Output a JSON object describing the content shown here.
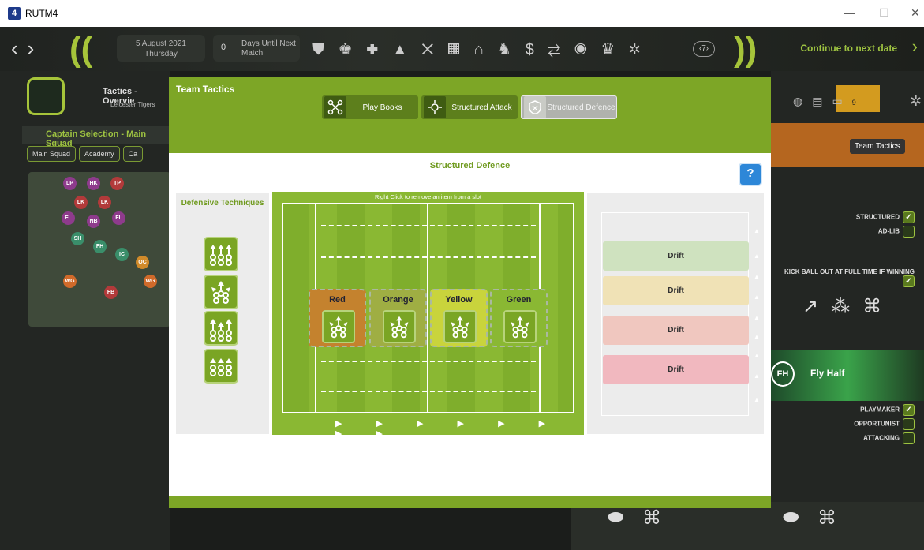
{
  "window": {
    "app_badge": "4",
    "title": "RUTM4",
    "minimize": "—",
    "maximize": "☐",
    "close": "✕"
  },
  "topbar": {
    "back": "‹",
    "forward": "›",
    "date": "5 August 2021",
    "weekday": "Thursday",
    "days_value": "0",
    "days_label_1": "Days Until Next",
    "days_label_2": "Match",
    "round_icon": "‹7›",
    "continue_label": "Continue to next date",
    "continue_arrow": "›",
    "nav_icons": [
      "shield-icon",
      "players-icon",
      "medical-icon",
      "training-cone-icon",
      "tactics-icon",
      "calendar-icon",
      "home-icon",
      "staff-icon",
      "finance-icon",
      "transfers-icon",
      "scouting-icon",
      "trophy-icon",
      "settings-icon"
    ]
  },
  "background_left": {
    "tactics_title": "Tactics - Overvie",
    "tactics_subtitle": "Leicester Tigers",
    "captain_title": "Captain Selection - Main Squad",
    "squad_tabs": [
      "Main Squad",
      "Academy",
      "Ca"
    ],
    "players": [
      {
        "label": "LP",
        "color": "#8e3b8c"
      },
      {
        "label": "HK",
        "color": "#8e3b8c"
      },
      {
        "label": "TP",
        "color": "#b23a3a"
      },
      {
        "label": "LK",
        "color": "#b23a3a"
      },
      {
        "label": "LK",
        "color": "#b23a3a"
      },
      {
        "label": "FL",
        "color": "#8e3b8c"
      },
      {
        "label": "NB",
        "color": "#8e3b8c"
      },
      {
        "label": "FL",
        "color": "#8e3b8c"
      },
      {
        "label": "SH",
        "color": "#3a8e6a"
      },
      {
        "label": "FH",
        "color": "#3a8e6a"
      },
      {
        "label": "IC",
        "color": "#3a8e6a"
      },
      {
        "label": "OC",
        "color": "#d08a2a"
      },
      {
        "label": "WG",
        "color": "#d06a2a"
      },
      {
        "label": "FB",
        "color": "#b23a3a"
      },
      {
        "label": "WG",
        "color": "#d06a2a"
      }
    ]
  },
  "background_right": {
    "inbox_count": "9",
    "team_tactics_label": "Team Tactics",
    "toggles": [
      {
        "label": "STRUCTURED",
        "checked": true
      },
      {
        "label": "AD-LIB",
        "checked": false
      },
      {
        "label": "KICK BALL OUT AT FULL TIME IF WINNING",
        "checked": true
      }
    ],
    "player_role_badge": "FH",
    "player_role": "Fly Half",
    "traits": [
      {
        "label": "PLAYMAKER",
        "checked": true
      },
      {
        "label": "OPPORTUNIST",
        "checked": false
      },
      {
        "label": "ATTACKING",
        "checked": false
      }
    ]
  },
  "modal": {
    "title": "Team Tactics",
    "tabs": [
      {
        "label": "Play Books",
        "icon": "playbook-icon",
        "active": false
      },
      {
        "label": "Structured Attack",
        "icon": "structured-attack-icon",
        "active": false
      },
      {
        "label": "Structured Defence",
        "icon": "structured-defence-icon",
        "active": true
      }
    ],
    "section_title": "Structured Defence",
    "help_label": "?",
    "techniques_title": "Defensive Techniques",
    "techniques": [
      "rush-defence-icon",
      "drift-defence-icon",
      "blitz-defence-icon",
      "flat-defence-icon"
    ],
    "pitch_notice": "Right Click to remove an item from a slot",
    "slots": [
      {
        "name": "Red",
        "color": "#c4822e"
      },
      {
        "name": "Orange",
        "color": "#9fae43"
      },
      {
        "name": "Yellow",
        "color": "#c9d43c"
      },
      {
        "name": "Green",
        "color": "#8ab833"
      }
    ],
    "pitch_arrows": "▶ ▶ ▶ ▶ ▶ ▶ ▶ ▶",
    "drift_rows": [
      {
        "label": "Drift",
        "color": "#cfe2bf"
      },
      {
        "label": "Drift",
        "color": "#f0e2b6"
      },
      {
        "label": "Drift",
        "color": "#f0c7bf"
      },
      {
        "label": "Drift",
        "color": "#f1b8bf"
      }
    ]
  }
}
